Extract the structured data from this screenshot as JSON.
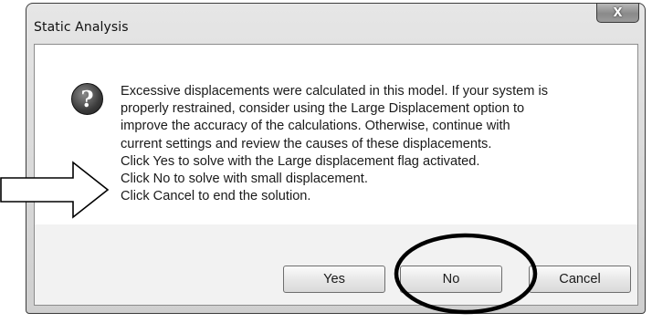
{
  "window": {
    "title": "Static Analysis",
    "close_glyph": "X"
  },
  "icon": {
    "name": "question-icon",
    "glyph": "?"
  },
  "message": {
    "lines": [
      "Excessive displacements were calculated in this model. If your system is",
      "properly restrained, consider using the Large Displacement option to",
      "improve the accuracy of the calculations.  Otherwise, continue with",
      "current settings and review the causes of these displacements.",
      "Click Yes to solve with the Large displacement flag activated.",
      "Click No to solve with small displacement.",
      "Click Cancel to end the solution."
    ]
  },
  "buttons": {
    "yes": "Yes",
    "no": "No",
    "cancel": "Cancel"
  },
  "annotations": {
    "arrow": "right-arrow-outline",
    "highlight": "ellipse-around-no-button"
  }
}
